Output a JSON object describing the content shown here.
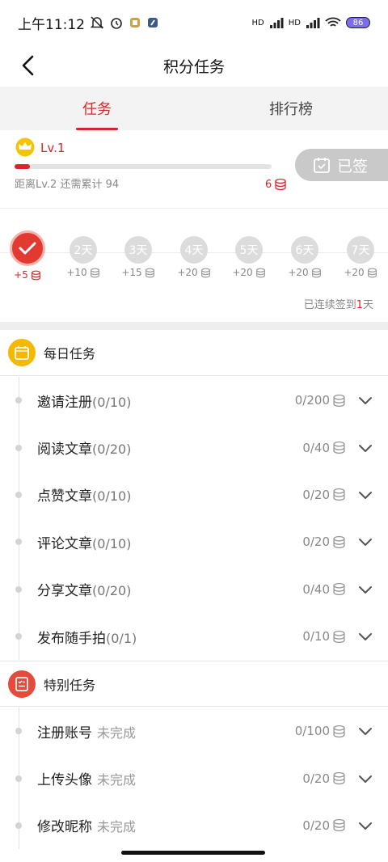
{
  "status": {
    "time": "上午11:12",
    "net1": "HD",
    "net2": "HD",
    "battery": "86"
  },
  "nav": {
    "title": "积分任务"
  },
  "tabs": [
    {
      "label": "任务"
    },
    {
      "label": "排行榜"
    }
  ],
  "level": {
    "name": "Lv.1",
    "hint": "距离Lv.2 还需累计 94",
    "coins": "6",
    "progress": 0.06,
    "signed_label": "已签"
  },
  "checkin": {
    "days": [
      {
        "label": "",
        "reward": "+5"
      },
      {
        "label": "2天",
        "reward": "+10"
      },
      {
        "label": "3天",
        "reward": "+15"
      },
      {
        "label": "4天",
        "reward": "+20"
      },
      {
        "label": "5天",
        "reward": "+20"
      },
      {
        "label": "6天",
        "reward": "+20"
      },
      {
        "label": "7天",
        "reward": "+20"
      }
    ],
    "streak_prefix": "已连续签到",
    "streak_num": "1",
    "streak_suffix": "天"
  },
  "daily": {
    "title": "每日任务",
    "tasks": [
      {
        "name": "邀请注册",
        "count": "(0/10)",
        "progress": "0/200"
      },
      {
        "name": "阅读文章",
        "count": "(0/20)",
        "progress": "0/40"
      },
      {
        "name": "点赞文章",
        "count": "(0/10)",
        "progress": "0/20"
      },
      {
        "name": "评论文章",
        "count": "(0/10)",
        "progress": "0/20"
      },
      {
        "name": "分享文章",
        "count": "(0/20)",
        "progress": "0/40"
      },
      {
        "name": "发布随手拍",
        "count": "(0/1)",
        "progress": "0/10"
      }
    ]
  },
  "special": {
    "title": "特别任务",
    "tasks": [
      {
        "name": "注册账号",
        "state": "未完成",
        "progress": "0/100"
      },
      {
        "name": "上传头像",
        "state": "未完成",
        "progress": "0/20"
      },
      {
        "name": "修改昵称",
        "state": "未完成",
        "progress": "0/20"
      }
    ]
  },
  "colors": {
    "accent": "#d9262a",
    "daily_icon": "#f5b800",
    "special_icon": "#e64a3a",
    "signed_btn": "#c9c9c9"
  }
}
